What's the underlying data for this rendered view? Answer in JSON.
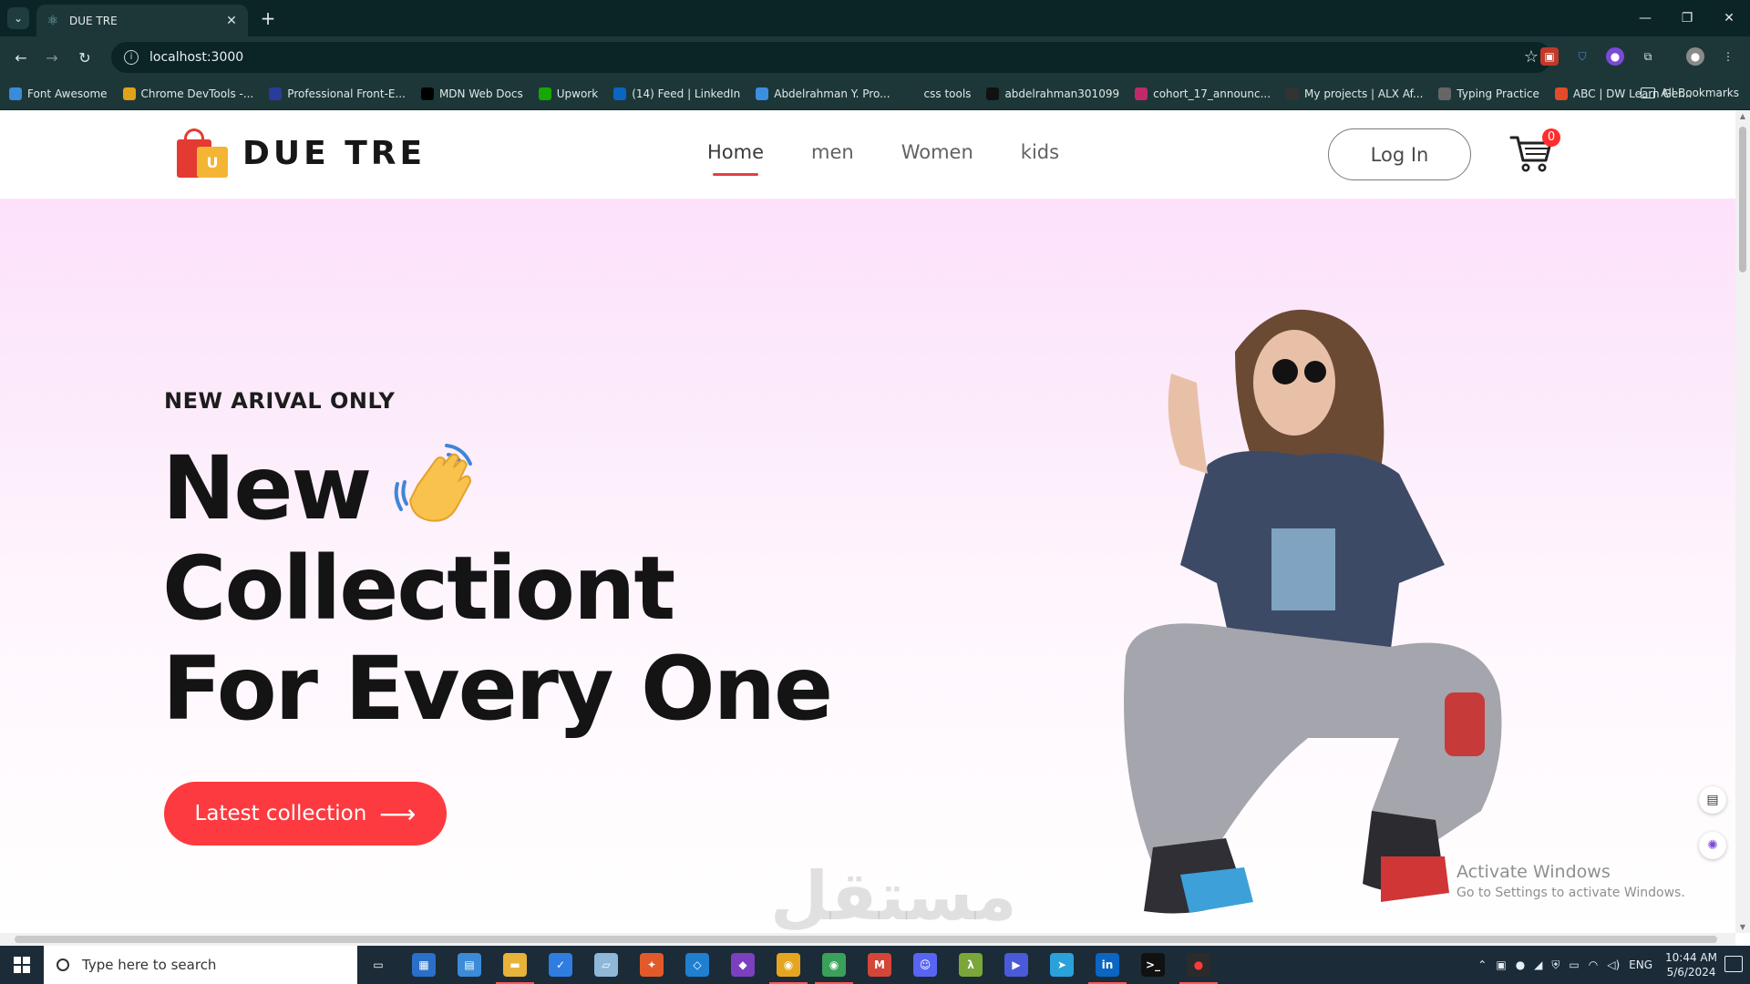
{
  "browser": {
    "tab_title": "DUE TRE",
    "url": "localhost:3000",
    "bookmarks": [
      {
        "label": "Font Awesome",
        "icon": "flag-icon",
        "color": "#3a8bd8"
      },
      {
        "label": "Chrome DevTools -...",
        "icon": "chrome-icon",
        "color": "#e0a21a"
      },
      {
        "label": "Professional Front-E...",
        "icon": "fem-icon",
        "color": "#2a3c9a"
      },
      {
        "label": "MDN Web Docs",
        "icon": "mdn-icon",
        "color": "#000000"
      },
      {
        "label": "Upwork",
        "icon": "upwork-icon",
        "color": "#14a800"
      },
      {
        "label": "(14) Feed | LinkedIn",
        "icon": "linkedin-icon",
        "color": "#0a66c2"
      },
      {
        "label": "Abdelrahman Y. Pro...",
        "icon": "bird-icon",
        "color": "#3b8ee0"
      },
      {
        "label": "css tools",
        "icon": "folder-icon",
        "color": "#1d3738"
      },
      {
        "label": "abdelrahman301099",
        "icon": "github-icon",
        "color": "#111111"
      },
      {
        "label": "cohort_17_announc...",
        "icon": "slack-icon",
        "color": "#c02a6a"
      },
      {
        "label": "My projects | ALX Af...",
        "icon": "alx-icon",
        "color": "#333333"
      },
      {
        "label": "Typing Practice",
        "icon": "keyboard-icon",
        "color": "#666666"
      },
      {
        "label": "ABC | DW Learn Ger...",
        "icon": "dw-icon",
        "color": "#e34b2a"
      }
    ],
    "all_bookmarks_label": "All Bookmarks"
  },
  "site": {
    "brand": "DUE TRE",
    "logo_letter": "U",
    "nav": [
      "Home",
      "men",
      "Women",
      "kids"
    ],
    "login_label": "Log In",
    "cart_count": "0"
  },
  "hero": {
    "kicker": "NEW ARIVAL ONLY",
    "line1": "New",
    "line2": "Collectiont",
    "line3": "For Every One",
    "cta_label": "Latest collection",
    "cta_arrow": "⟶"
  },
  "overlay": {
    "watermark": "مستقل",
    "activate_title": "Activate Windows",
    "activate_sub": "Go to Settings to activate Windows."
  },
  "taskbar": {
    "search_placeholder": "Type here to search",
    "language": "ENG",
    "time": "10:44 AM",
    "date": "5/6/2024"
  },
  "colors": {
    "accent": "#fd3a3f",
    "chrome_bg": "#1d3738",
    "hero_pink": "#fde1fb"
  }
}
